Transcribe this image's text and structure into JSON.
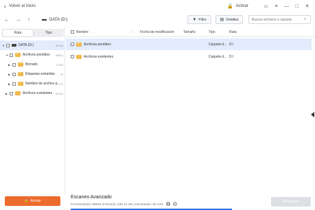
{
  "titlebar": {
    "back_label": "Volver al Inicio",
    "activar_label": "Activar"
  },
  "nav": {
    "drive_label": "DATA (D:)",
    "filtro_label": "Filtro",
    "detalles_label": "Detalles",
    "search_placeholder": "Buscar archivos o carpeta"
  },
  "sidebar": {
    "tabs": [
      "Ruta",
      "Tipo"
    ],
    "tree": [
      {
        "label": "DATA (D:)",
        "count": "99948"
      },
      {
        "label": "Archivos perdidos",
        "count": "98824"
      },
      {
        "label": "Borrado",
        "count": "17930"
      },
      {
        "label": "Etiquetas extraídas",
        "count": "39"
      },
      {
        "label": "Nombre de archivo p...",
        "count": "37"
      },
      {
        "label": "Archivos existentes",
        "count": "81024"
      }
    ],
    "activar_button": "Activar"
  },
  "table": {
    "columns": [
      "Nombre",
      "Fecha de modificación",
      "Tamaño",
      "Tipo",
      "Ruta"
    ],
    "rows": [
      {
        "name": "Archivos perdidos",
        "date": "",
        "size": "",
        "type": "Carpeta d...",
        "path": "D:\\"
      },
      {
        "name": "Archivos existentes",
        "date": "",
        "size": "",
        "type": "Carpeta d...",
        "path": "D:\\"
      }
    ]
  },
  "status": {
    "title": "Escaneo Avanzado",
    "info": "Encontrado(s): 99948 archivo(s), 836.13 GB | Escaneado: 86.13%",
    "progress_fraction": 0.6613,
    "recuperar_label": "Recuperar"
  },
  "colors": {
    "accent_orange": "#ec6b2d",
    "accent_blue": "#2f6fe4",
    "selected_row": "#e3ecfc",
    "folder": "#f2b84a"
  }
}
